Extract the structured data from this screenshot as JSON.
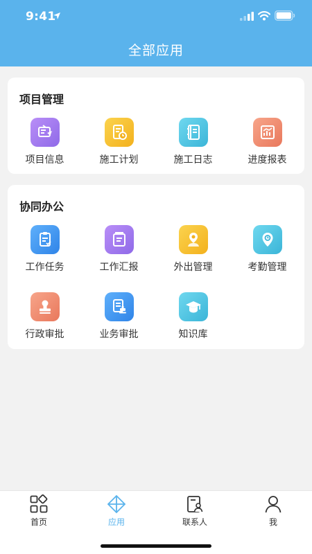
{
  "status_bar": {
    "time": "9:41"
  },
  "nav": {
    "title": "全部应用"
  },
  "sections": [
    {
      "title": "项目管理",
      "items": [
        {
          "label": "项目信息",
          "icon": "project-info-icon",
          "color": "#a77cf2"
        },
        {
          "label": "施工计划",
          "icon": "construction-plan-icon",
          "color": "#f7c23a"
        },
        {
          "label": "施工日志",
          "icon": "construction-log-icon",
          "color": "#4fc8e6"
        },
        {
          "label": "进度报表",
          "icon": "progress-report-icon",
          "color": "#f0896c"
        }
      ]
    },
    {
      "title": "协同办公",
      "items": [
        {
          "label": "工作任务",
          "icon": "work-task-icon",
          "color": "#4a9cf3"
        },
        {
          "label": "工作汇报",
          "icon": "work-report-icon",
          "color": "#a77cf2"
        },
        {
          "label": "外出管理",
          "icon": "outing-management-icon",
          "color": "#f7c23a"
        },
        {
          "label": "考勤管理",
          "icon": "attendance-icon",
          "color": "#4fc8e6"
        },
        {
          "label": "行政审批",
          "icon": "admin-approval-icon",
          "color": "#f0896c"
        },
        {
          "label": "业务审批",
          "icon": "business-approval-icon",
          "color": "#4a9cf3"
        },
        {
          "label": "知识库",
          "icon": "knowledge-base-icon",
          "color": "#4fc8e6"
        }
      ]
    }
  ],
  "tabbar": {
    "items": [
      {
        "label": "首页",
        "icon": "home-grid-icon",
        "active": false
      },
      {
        "label": "应用",
        "icon": "apps-icon",
        "active": true
      },
      {
        "label": "联系人",
        "icon": "contacts-icon",
        "active": false
      },
      {
        "label": "我",
        "icon": "profile-icon",
        "active": false
      }
    ],
    "active_color": "#5ab3ec"
  }
}
